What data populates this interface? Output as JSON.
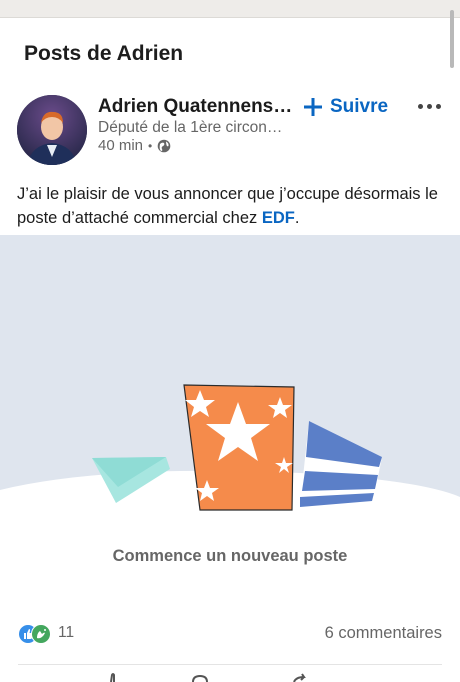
{
  "page": {
    "title": "Posts de Adrien"
  },
  "post": {
    "author": {
      "name": "Adrien Quatennens…",
      "subtitle": "Député de la 1ère circon…",
      "time": "40 min",
      "visibility_icon": "globe-icon"
    },
    "follow_label": "Suivre",
    "more_icon": "more-horizontal-icon",
    "text_before": "J’ai le plaisir de vous annoncer que j’occupe désormais le poste d’attaché commercial chez ",
    "text_tag": "EDF",
    "text_after": ".",
    "cta": "Commence un nouveau poste",
    "reactions_count": "11",
    "comments": "6 commentaires"
  },
  "colors": {
    "accent": "#0a66c2",
    "illustration_bg": "#dfe5ee",
    "orange": "#f58b4b",
    "teal": "#9fe3dd",
    "blue": "#5b7fc8"
  }
}
